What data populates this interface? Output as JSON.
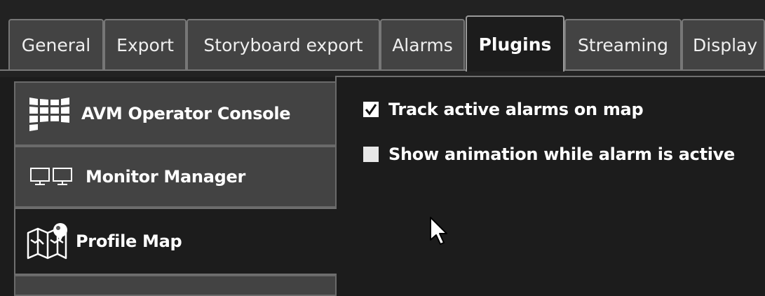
{
  "tabs": [
    {
      "label": "General",
      "active": false
    },
    {
      "label": "Export",
      "active": false
    },
    {
      "label": "Storyboard export",
      "active": false
    },
    {
      "label": "Alarms",
      "active": false
    },
    {
      "label": "Plugins",
      "active": true
    },
    {
      "label": "Streaming",
      "active": false
    },
    {
      "label": "Display",
      "active": false
    }
  ],
  "sidebar": {
    "items": [
      {
        "label": "AVM Operator Console",
        "icon": "video-wall-icon",
        "active": false
      },
      {
        "label": "Monitor Manager",
        "icon": "monitors-icon",
        "active": false
      },
      {
        "label": "Profile Map",
        "icon": "map-pin-icon",
        "active": true
      }
    ]
  },
  "options": [
    {
      "label": "Track active alarms on map",
      "checked": true
    },
    {
      "label": "Show animation while alarm is active",
      "checked": false
    }
  ]
}
